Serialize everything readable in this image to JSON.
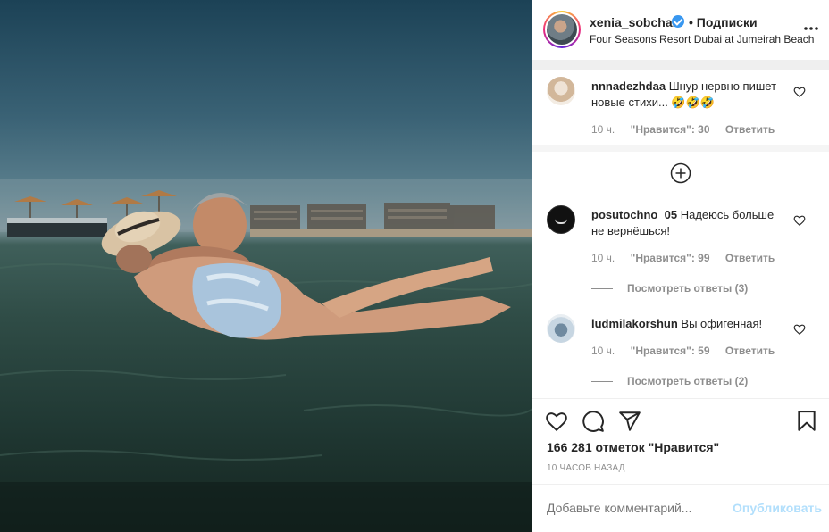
{
  "header": {
    "username": "xenia_sobchak",
    "follow_label": "• Подписки",
    "location": "Four Seasons Resort Dubai at Jumeirah Beach",
    "more_icon": "more-horizontal-icon",
    "verified_icon": "verified-badge-icon"
  },
  "comments": [
    {
      "username": "nnnadezhdaa",
      "text": "Шнур нервно пишет новые стихи... 🤣🤣🤣",
      "time": "10 ч.",
      "likes": "\"Нравится\": 30",
      "reply_label": "Ответить"
    },
    {
      "username": "posutochno_05",
      "text": "Надеюсь больше не вернёшься!",
      "time": "10 ч.",
      "likes": "\"Нравится\": 99",
      "reply_label": "Ответить",
      "view_replies": "Посмотреть ответы (3)"
    },
    {
      "username": "ludmilakorshun",
      "text": "Вы офигенная!",
      "time": "10 ч.",
      "likes": "\"Нравится\": 59",
      "reply_label": "Ответить",
      "view_replies": "Посмотреть ответы (2)"
    }
  ],
  "load_more_icon": "plus-circle-icon",
  "actions": {
    "likes_count": "166 281 отметок \"Нравится\"",
    "time_ago": "10 ЧАСОВ НАЗАД",
    "icons": [
      "heart-icon",
      "comment-icon",
      "share-icon",
      "bookmark-icon"
    ]
  },
  "add_comment": {
    "placeholder": "Добавьте комментарий...",
    "post_label": "Опубликовать"
  },
  "colors": {
    "text": "#262626",
    "secondary": "#8e8e8e",
    "link_disabled": "#b2dffc",
    "verified": "#3897f0"
  }
}
